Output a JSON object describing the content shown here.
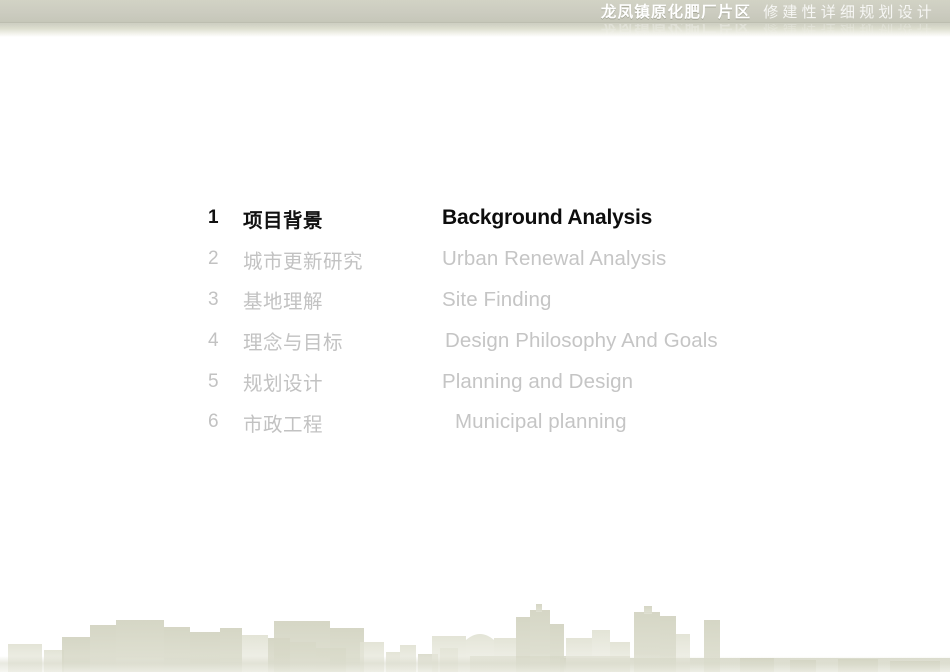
{
  "header": {
    "title_main": "龙凤镇原化肥厂片区",
    "title_sub": "修建性详细规划设计",
    "band_color": "#ccccc0",
    "title_color": "#ffffff"
  },
  "agenda": {
    "active_index": 0,
    "active_color": "#111111",
    "inactive_color": "#c2c2c2",
    "items": [
      {
        "num": "1",
        "cn": "项目背景",
        "en": "Background Analysis"
      },
      {
        "num": "2",
        "cn": "城市更新研究",
        "en": "Urban Renewal Analysis"
      },
      {
        "num": "3",
        "cn": "基地理解",
        "en": "Site Finding"
      },
      {
        "num": "4",
        "cn": "理念与目标",
        "en": "Design Philosophy And Goals"
      },
      {
        "num": "5",
        "cn": "规划设计",
        "en": "Planning and Design"
      },
      {
        "num": "6",
        "cn": "市政工程",
        "en": "Municipal planning"
      }
    ]
  },
  "footer": {
    "graphic": "cityscape-silhouette",
    "building_color": "#d3d4c2",
    "building_color_light": "#e2e3d5",
    "haze_color": "#d6d7c7"
  }
}
